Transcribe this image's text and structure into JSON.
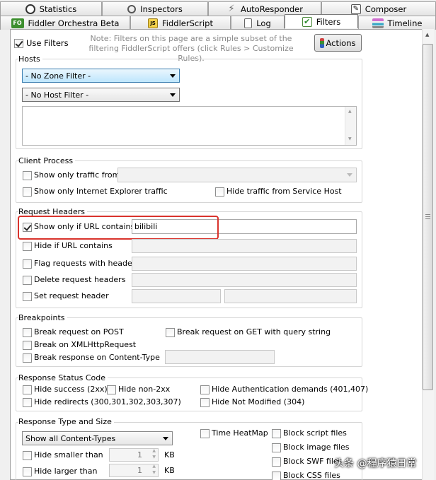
{
  "tabs_row1": [
    {
      "label": "Statistics",
      "icon": "stopwatch-icon"
    },
    {
      "label": "Inspectors",
      "icon": "magnifier-icon"
    },
    {
      "label": "AutoResponder",
      "icon": "lightning-icon"
    },
    {
      "label": "Composer",
      "icon": "pencil-icon"
    }
  ],
  "tabs_row2": [
    {
      "label": "Fiddler Orchestra Beta",
      "icon": "fo-icon",
      "badge": "FO"
    },
    {
      "label": "FiddlerScript",
      "icon": "js-icon",
      "badge": "JS"
    },
    {
      "label": "Log",
      "icon": "document-icon"
    },
    {
      "label": "Filters",
      "icon": "checkbox-icon",
      "selected": true
    },
    {
      "label": "Timeline",
      "icon": "timeline-icon"
    }
  ],
  "colors": {
    "accent_orange": "#e87b19",
    "highlight_red": "#d9332c",
    "fo_green": "#3d8f2f",
    "tab_blue": "#3c7fb1"
  },
  "use_filters": {
    "label": "Use Filters",
    "checked": true
  },
  "note": "Note: Filters on this page are a simple subset of the filtering FiddlerScript offers (click Rules > Customize Rules).",
  "actions_label": "Actions",
  "hosts": {
    "title": "Hosts",
    "zone_filter": "- No Zone Filter -",
    "host_filter": "- No Host Filter -",
    "hosts_text": ""
  },
  "client_process": {
    "title": "Client Process",
    "show_only_traffic_from": "Show only traffic from",
    "show_only_ie": "Show only Internet Explorer traffic",
    "hide_service_host": "Hide traffic from Service Host"
  },
  "request_headers": {
    "title": "Request Headers",
    "show_only_url": "Show only if URL contains",
    "show_only_url_value": "bilibili",
    "hide_url": "Hide if URL contains",
    "flag_headers": "Flag requests with headers",
    "delete_headers": "Delete request headers",
    "set_header": "Set request header"
  },
  "breakpoints": {
    "title": "Breakpoints",
    "post": "Break request on POST",
    "get_qs": "Break request on GET with query string",
    "xhr": "Break on XMLHttpRequest",
    "content_type": "Break response on Content-Type"
  },
  "response_status": {
    "title": "Response Status Code",
    "hide_success": "Hide success (2xx)",
    "hide_non2xx": "Hide non-2xx",
    "hide_auth": "Hide Authentication demands (401,407)",
    "hide_redirects": "Hide redirects (300,301,302,303,307)",
    "hide_not_modified": "Hide Not Modified (304)"
  },
  "response_type": {
    "title": "Response Type and Size",
    "content_types": "Show all Content-Types",
    "time_heatmap": "Time HeatMap",
    "hide_smaller": "Hide smaller than",
    "hide_larger": "Hide larger than",
    "smaller_value": "1",
    "larger_value": "1",
    "unit": "KB",
    "block_script": "Block script files",
    "block_image": "Block image files",
    "block_swf": "Block SWF files",
    "block_css": "Block CSS files"
  },
  "watermark": "头条 @程序猿日常"
}
